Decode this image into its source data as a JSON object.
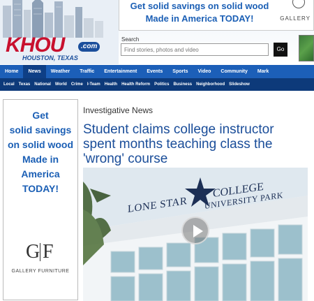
{
  "header": {
    "logo_text": "KHOU",
    "logo_domain": ".com",
    "logo_location": "HOUSTON, TEXAS",
    "top_ad": {
      "headline": "Get solid savings on solid wood Made in America TODAY!",
      "brand": "GALLERY"
    },
    "search": {
      "label": "Search",
      "placeholder": "Find stories, photos and video",
      "button": "Go"
    }
  },
  "nav": {
    "items": [
      "Home",
      "News",
      "Weather",
      "Traffic",
      "Entertainment",
      "Events",
      "Sports",
      "Video",
      "Community",
      "Mark"
    ],
    "active": "News"
  },
  "subnav": {
    "items": [
      "Local",
      "Texas",
      "National",
      "World",
      "Crime",
      "I-Team",
      "Health",
      "Health Reform",
      "Politics",
      "Business",
      "Neighborhood",
      "Slideshow"
    ]
  },
  "left_ad": {
    "text": "Get\nsolid savings\non solid wood\nMade in\nAmerica\nTODAY!",
    "logo_left": "G",
    "logo_right": "F",
    "brand": "GALLERY FURNITURE"
  },
  "article": {
    "kicker": "Investigative News",
    "headline": "Student claims college instructor spent months teaching class the 'wrong' course"
  },
  "video": {
    "sign_line_1": "LONE STAR",
    "sign_line_2": "COLLEGE",
    "sign_line_3": "UNIVERSITY PARK"
  },
  "colors": {
    "nav_blue": "#1c5fb8",
    "subnav_blue": "#0d3a7a",
    "headline_blue": "#1a4d99",
    "logo_red": "#c8102e"
  }
}
